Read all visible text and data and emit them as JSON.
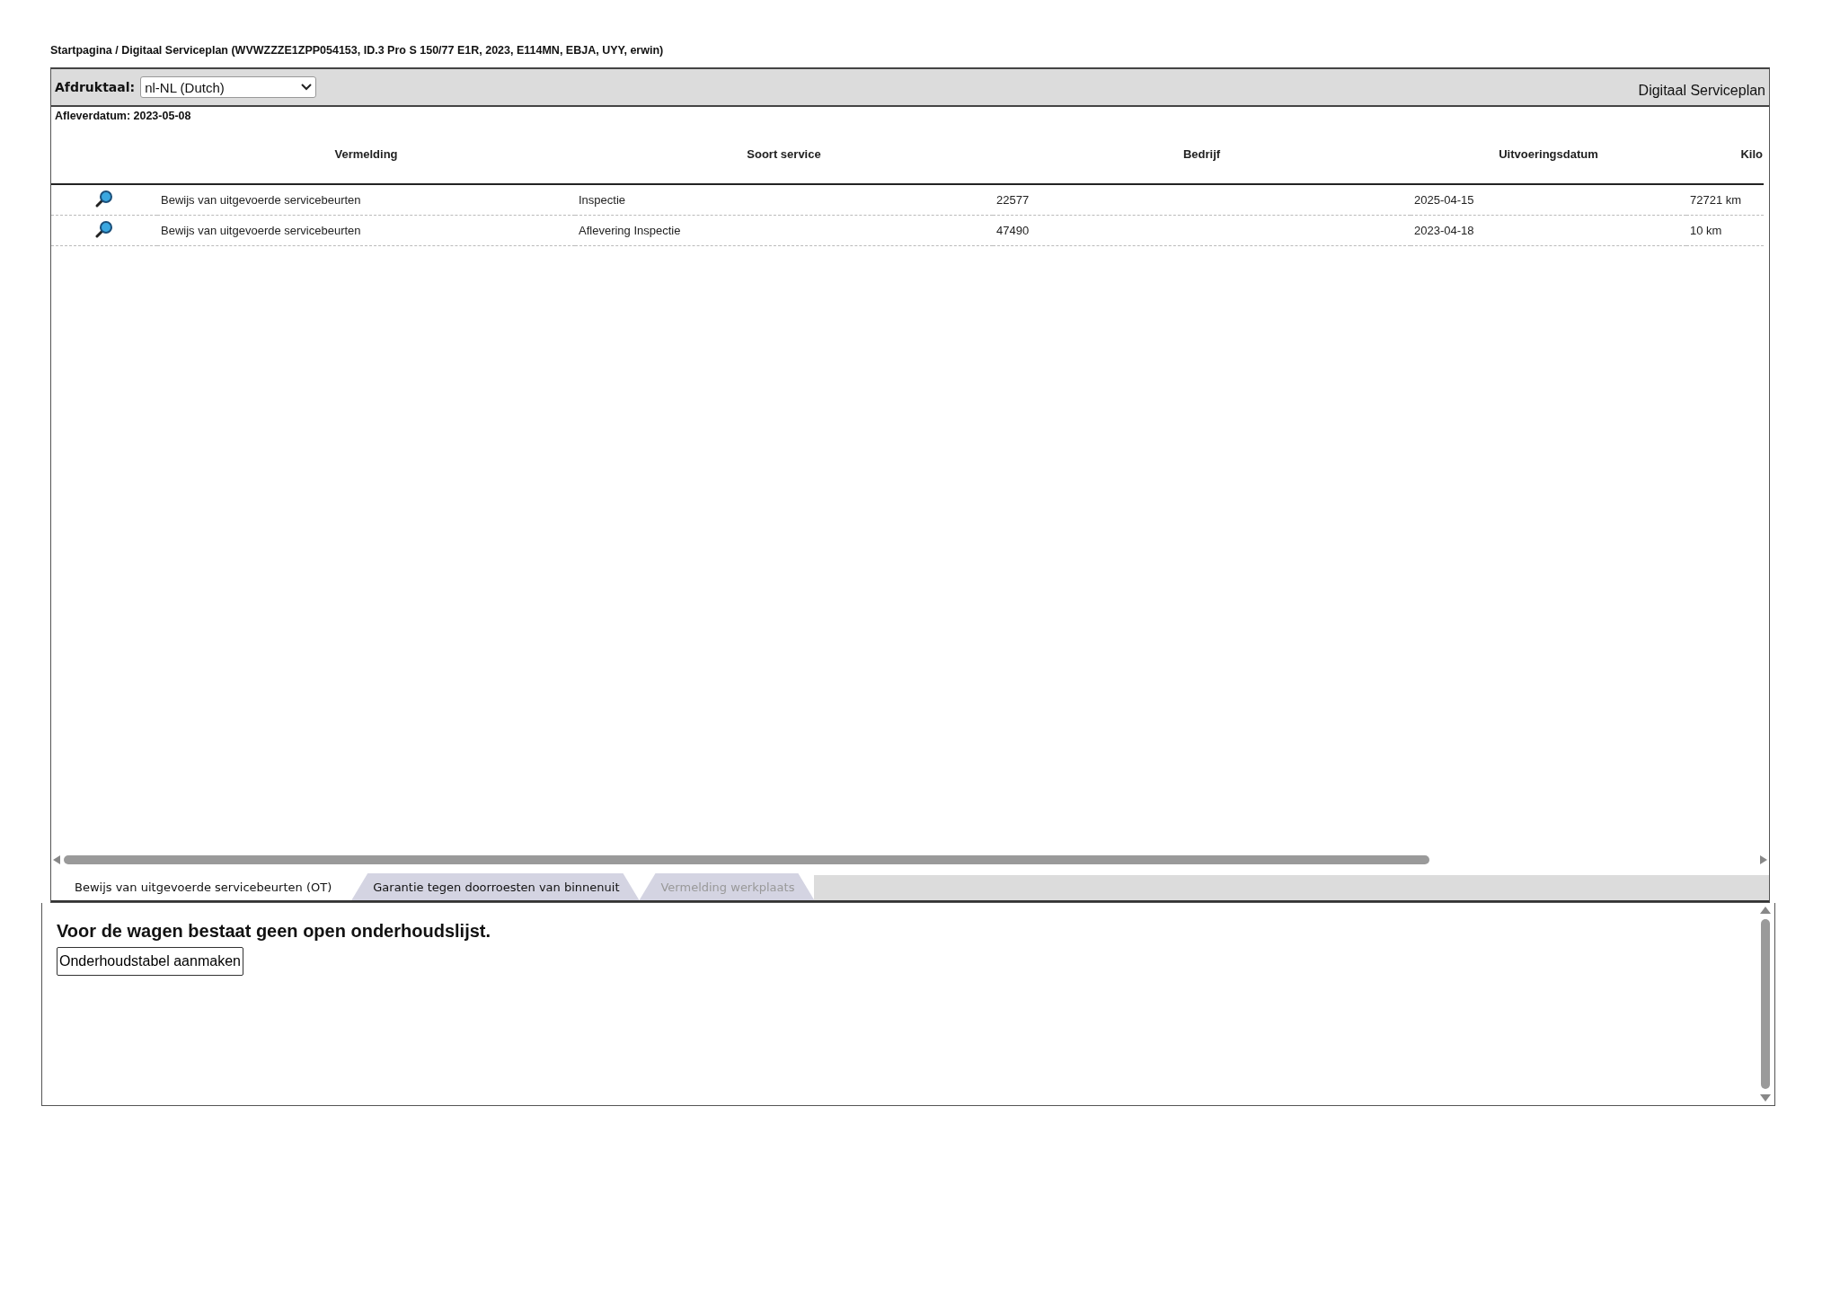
{
  "breadcrumb": "Startpagina / Digitaal Serviceplan (WVWZZZE1ZPP054153, ID.3 Pro S 150/77 E1R, 2023, E114MN, EBJA, UYY, erwin)",
  "toolbar": {
    "language_label": "Afdruktaal:",
    "language_value": "nl-NL (Dutch)",
    "title": "Digitaal Serviceplan"
  },
  "delivery_date": "Afleverdatum: 2023-05-08",
  "table": {
    "columns": [
      "Vermelding",
      "Soort service",
      "Bedrijf",
      "Uitvoeringsdatum",
      "Kilo"
    ],
    "rows": [
      {
        "cells": [
          "Bewijs van uitgevoerde servicebeurten",
          "Inspectie",
          "22577",
          "2025-04-15",
          "72721 km"
        ]
      },
      {
        "cells": [
          "Bewijs van uitgevoerde servicebeurten",
          "Aflevering Inspectie",
          "47490",
          "2023-04-18",
          "10 km"
        ]
      }
    ]
  },
  "tabs": [
    {
      "label": "Bewijs van uitgevoerde servicebeurten (OT)",
      "selected": true,
      "disabled": false
    },
    {
      "label": "Garantie tegen doorroesten van binnenuit",
      "selected": false,
      "disabled": false
    },
    {
      "label": "Vermelding werkplaats",
      "selected": false,
      "disabled": true
    }
  ],
  "message": "Voor de wagen bestaat geen open onderhoudslijst.",
  "button": "Onderhoudstabel aanmaken"
}
